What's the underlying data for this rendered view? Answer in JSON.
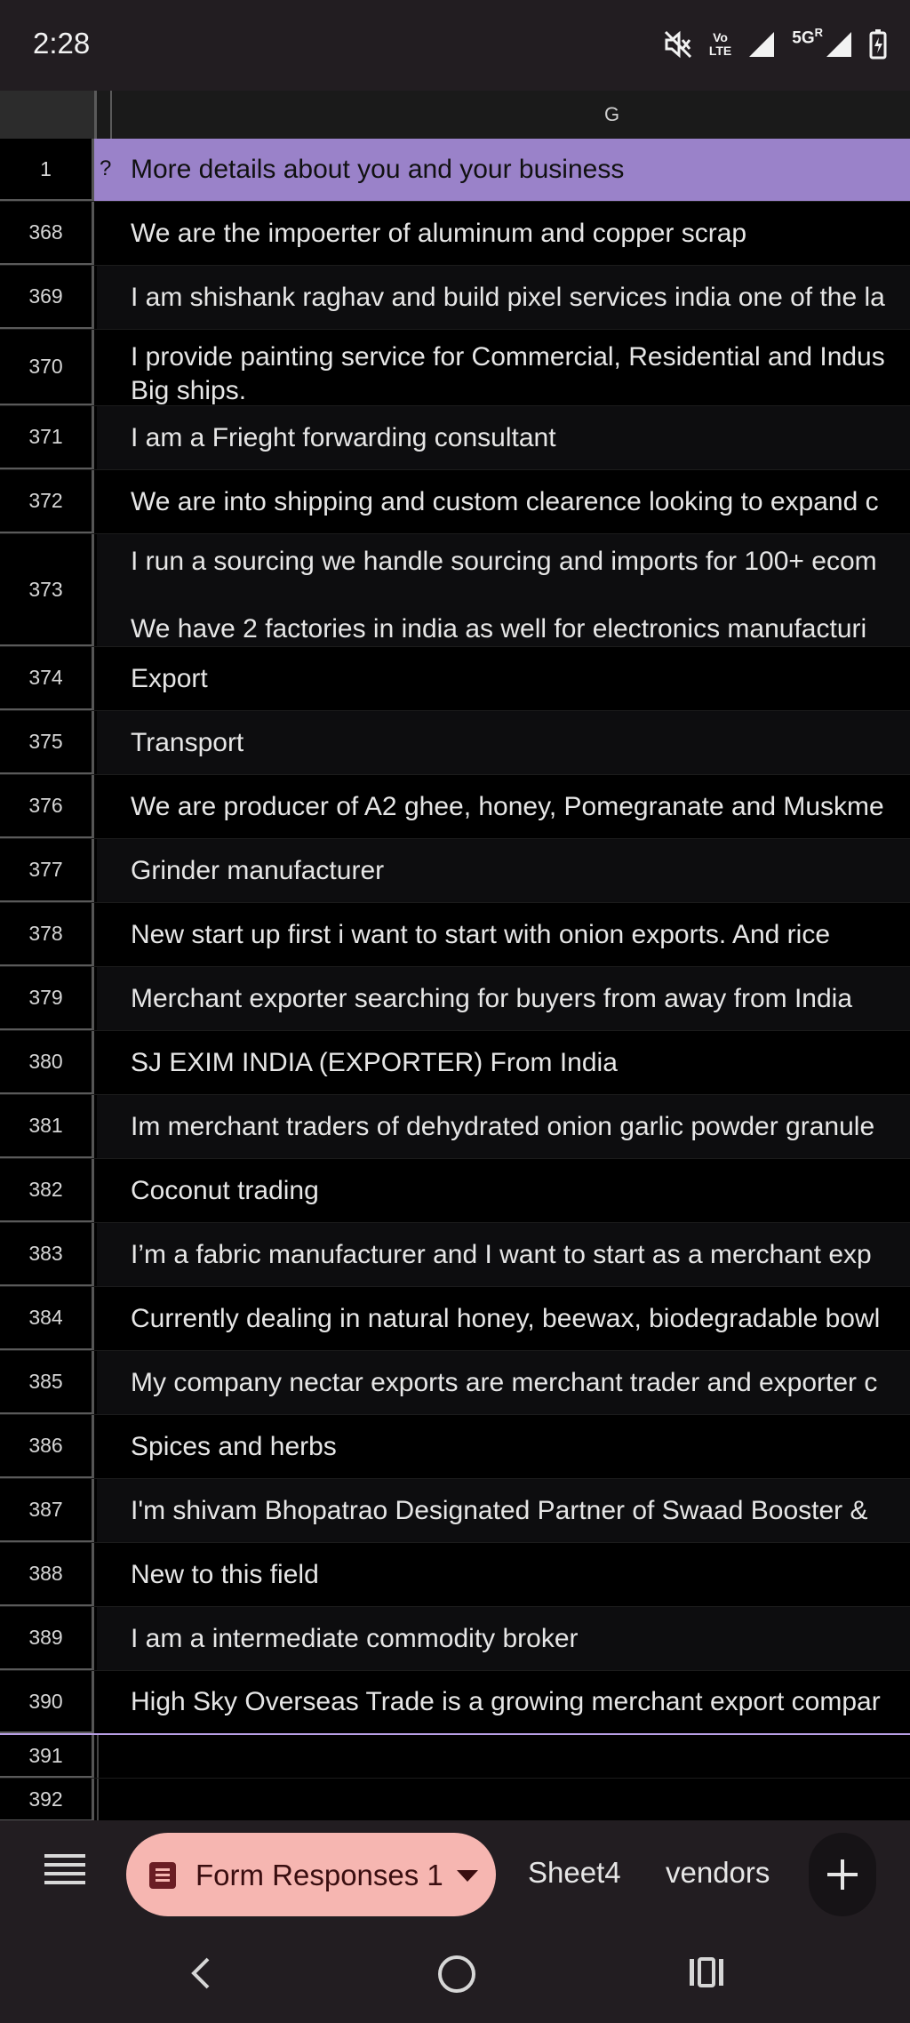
{
  "status_bar": {
    "time": "2:28",
    "icons": [
      "mute-icon",
      "volte-icon",
      "signal-icon",
      "5g-signal-icon",
      "battery-charging-icon"
    ],
    "volte_label_top": "Vo",
    "volte_label_bottom": "LTE",
    "network_label": "5G",
    "roaming_label": "R"
  },
  "sheet": {
    "column_letter": "G",
    "header_row_number": "1",
    "header_marker": "?",
    "header_text": "More details about you and your business",
    "rows": [
      {
        "num": "368",
        "text": "We are the impoerter of aluminum and copper scrap"
      },
      {
        "num": "369",
        "text": "I am shishank raghav and build pixel services india one of the la"
      },
      {
        "num": "370",
        "text": "I provide painting service for Commercial, Residential and Indus",
        "text2": "Big ships."
      },
      {
        "num": "371",
        "text": "I am a Frieght forwarding consultant"
      },
      {
        "num": "372",
        "text": "We are into shipping and custom clearence looking to expand c"
      },
      {
        "num": "373",
        "text": "I run a sourcing we handle sourcing and imports for 100+ ecom",
        "text2": "We have 2 factories in india as well for electronics manufacturi"
      },
      {
        "num": "374",
        "text": "Export"
      },
      {
        "num": "375",
        "text": "Transport"
      },
      {
        "num": "376",
        "text": "We are producer of A2 ghee, honey, Pomegranate and Muskme"
      },
      {
        "num": "377",
        "text": "Grinder manufacturer"
      },
      {
        "num": "378",
        "text": "New start up first i want to start with onion exports. And rice"
      },
      {
        "num": "379",
        "text": "Merchant exporter searching for buyers from away from India"
      },
      {
        "num": "380",
        "text": "SJ EXIM INDIA (EXPORTER) From India"
      },
      {
        "num": "381",
        "text": "Im merchant traders of dehydrated onion garlic powder granule"
      },
      {
        "num": "382",
        "text": "Coconut trading"
      },
      {
        "num": "383",
        "text": "I’m a fabric manufacturer and I want to start as a merchant exp"
      },
      {
        "num": "384",
        "text": "Currently dealing in natural honey, beewax, biodegradable bowl"
      },
      {
        "num": "385",
        "text": "My company nectar exports are merchant trader and exporter c"
      },
      {
        "num": "386",
        "text": "Spices and herbs"
      },
      {
        "num": "387",
        "text": "I'm shivam Bhopatrao Designated Partner of Swaad Booster &"
      },
      {
        "num": "388",
        "text": "New to this field"
      },
      {
        "num": "389",
        "text": "I am a intermediate commodity broker"
      },
      {
        "num": "390",
        "text": "High Sky Overseas Trade is a growing merchant export compar"
      },
      {
        "num": "391",
        "text": ""
      },
      {
        "num": "392",
        "text": ""
      }
    ]
  },
  "tabs": {
    "active": "Form Responses 1",
    "others": [
      "Sheet4",
      "vendors"
    ]
  }
}
